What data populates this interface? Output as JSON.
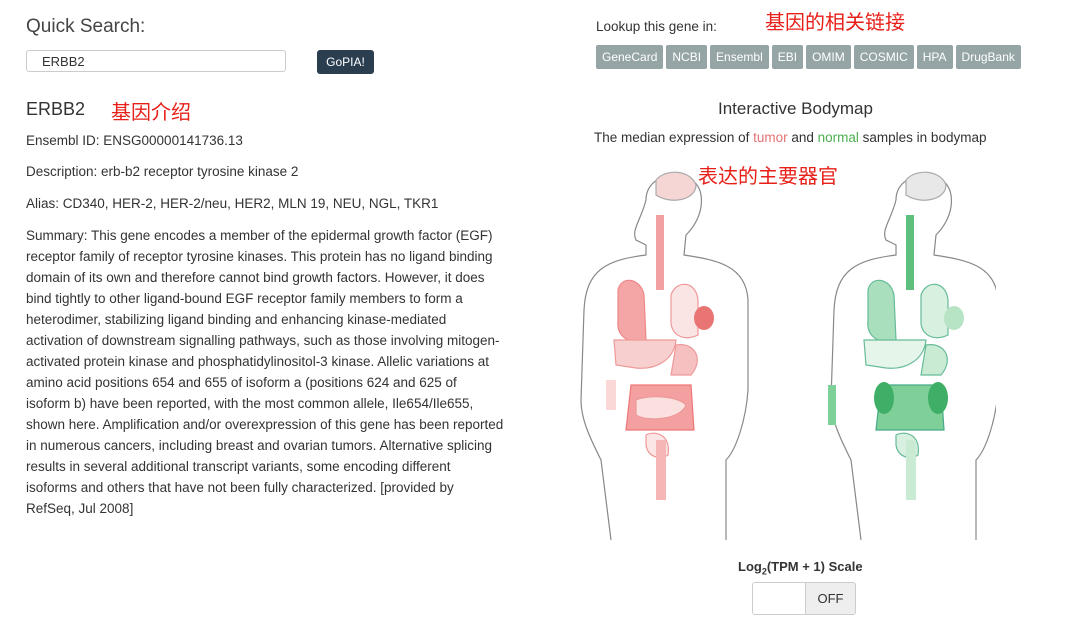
{
  "quick_search": {
    "label": "Quick Search:",
    "value": "ERBB2",
    "button": "GoPIA!"
  },
  "gene": {
    "symbol": "ERBB2",
    "ensembl": "Ensembl ID: ENSG00000141736.13",
    "description": "Description: erb-b2 receptor tyrosine kinase 2",
    "alias": "Alias: CD340, HER-2, HER-2/neu, HER2, MLN 19, NEU, NGL, TKR1",
    "summary": "Summary: This gene encodes a member of the epidermal growth factor (EGF) receptor family of receptor tyrosine kinases. This protein has no ligand binding domain of its own and therefore cannot bind growth factors. However, it does bind tightly to other ligand-bound EGF receptor family members to form a heterodimer, stabilizing ligand binding and enhancing kinase-mediated activation of downstream signalling pathways, such as those involving mitogen-activated protein kinase and phosphatidylinositol-3 kinase. Allelic variations at amino acid positions 654 and 655 of isoform a (positions 624 and 625 of isoform b) have been reported, with the most common allele, Ile654/Ile655, shown here. Amplification and/or overexpression of this gene has been reported in numerous cancers, including breast and ovarian tumors. Alternative splicing results in several additional transcript variants, some encoding different isoforms and others that have not been fully characterized. [provided by RefSeq, Jul 2008]"
  },
  "lookup": {
    "label": "Lookup this gene in:",
    "links": [
      "GeneCard",
      "NCBI",
      "Ensembl",
      "EBI",
      "OMIM",
      "COSMIC",
      "HPA",
      "DrugBank"
    ]
  },
  "annotations": {
    "links_note": "基因的相关链接",
    "intro_note": "基因介绍",
    "organs_note": "表达的主要器官"
  },
  "bodymap": {
    "title": "Interactive Bodymap",
    "desc_prefix": "The median expression of ",
    "tumor_word": "tumor",
    "desc_mid": " and ",
    "normal_word": "normal",
    "desc_suffix": " samples in bodymap",
    "tumor_color": "#e57373",
    "normal_color": "#4caf50"
  },
  "scale": {
    "label_prefix": "Log",
    "label_sub": "2",
    "label_suffix": "(TPM + 1) Scale",
    "toggle_text": "OFF"
  }
}
